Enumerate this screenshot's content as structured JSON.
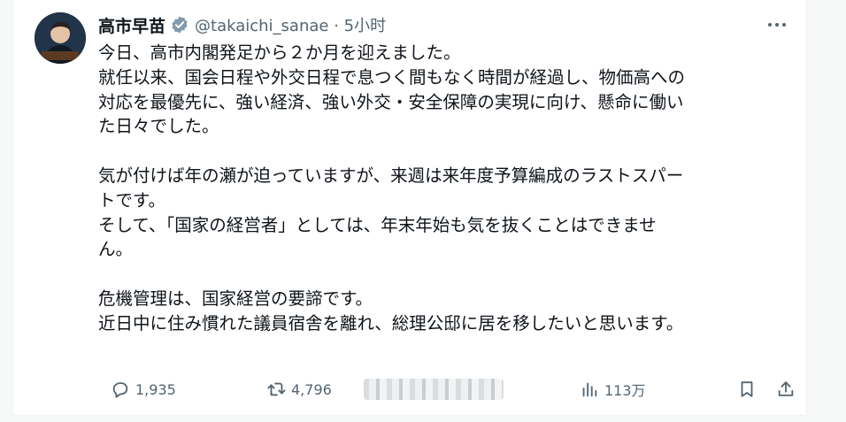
{
  "tweet": {
    "display_name": "高市早苗",
    "handle": "@takaichi_sanae · 5小时",
    "lines": [
      "今日、高市内閣発足から２か月を迎えました。",
      "就任以来、国会日程や外交日程で息つく間もなく時間が経過し、物価高への",
      "対応を最優先に、強い経済、強い外交・安全保障の実現に向け、懸命に働い",
      "た日々でした。",
      "",
      "気が付けば年の瀬が迫っていますが、来週は来年度予算編成のラストスパー",
      "トです。",
      "そして、「国家の経営者」としては、年末年始も気を抜くことはできませ",
      "ん。",
      "",
      "危機管理は、国家経営の要諦です。",
      "近日中に住み慣れた議員宿舎を離れ、総理公邸に居を移したいと思います。"
    ]
  },
  "actions": {
    "replies": "1,935",
    "reposts": "4,796",
    "views": "113万"
  },
  "colors": {
    "verified": "#829aab",
    "muted": "#536471",
    "text": "#0f1419"
  },
  "icons": [
    "verified-badge-icon",
    "more-icon",
    "reply-icon",
    "repost-icon",
    "views-icon",
    "bookmark-icon",
    "share-icon"
  ]
}
